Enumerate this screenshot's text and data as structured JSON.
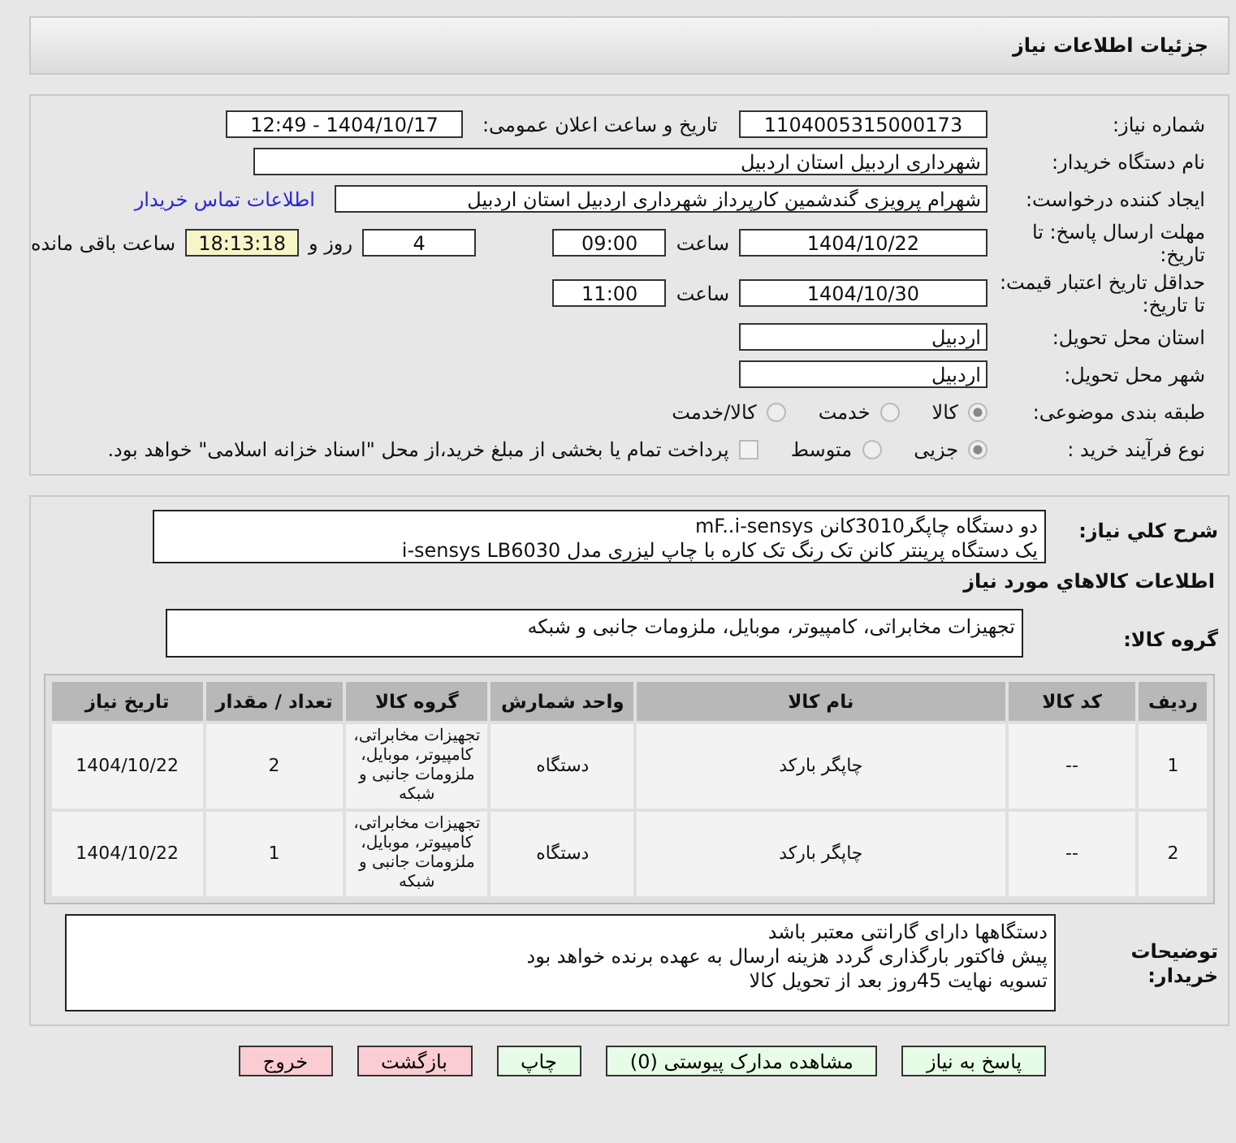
{
  "header": {
    "title": "جزئیات اطلاعات نیاز"
  },
  "need_number": {
    "label": "شماره نیاز:",
    "value": "1104005315000173"
  },
  "announce": {
    "label": "تاریخ و ساعت اعلان عمومی:",
    "value": "1404/10/17 - 12:49"
  },
  "buyer_org": {
    "label": "نام دستگاه خریدار:",
    "value": "شهرداری اردبیل استان اردبیل"
  },
  "requester": {
    "label": "ایجاد کننده درخواست:",
    "value": "شهرام پرویزی گندشمین کارپرداز شهرداری اردبیل استان اردبیل",
    "link": "اطلاعات تماس خریدار"
  },
  "deadline": {
    "label": "مهلت ارسال پاسخ: تا تاریخ:",
    "date": "1404/10/22",
    "time_label": "ساعت",
    "time": "09:00",
    "days": "4",
    "days_label": "روز و",
    "remaining": "18:13:18",
    "remaining_label": "ساعت باقی مانده"
  },
  "validity": {
    "label": "حداقل تاریخ اعتبار قیمت: تا تاریخ:",
    "date": "1404/10/30",
    "time_label": "ساعت",
    "time": "11:00"
  },
  "province": {
    "label": "استان محل تحویل:",
    "value": "اردبیل"
  },
  "city": {
    "label": "شهر محل تحویل:",
    "value": "اردبیل"
  },
  "category": {
    "label": "طبقه بندی موضوعی:",
    "options": [
      {
        "label": "کالا",
        "selected": true
      },
      {
        "label": "خدمت",
        "selected": false
      },
      {
        "label": "کالا/خدمت",
        "selected": false
      }
    ]
  },
  "process": {
    "label": "نوع فرآیند خرید :",
    "options": [
      {
        "label": "جزیی",
        "selected": true
      },
      {
        "label": "متوسط",
        "selected": false
      }
    ],
    "payment": {
      "label": "پرداخت تمام یا بخشی از مبلغ خرید،از محل \"اسناد خزانه اسلامی\" خواهد بود.",
      "checked": false
    }
  },
  "description": {
    "label": "شرح كلي نياز:",
    "lines": [
      "دو دستگاه چاپگر3010کانن mF..i-sensys",
      "یک دستگاه پرینتر کانن تک رنگ تک کاره با چاپ لیزری مدل i-sensys LB6030"
    ]
  },
  "goods_title": "اطلاعات كالاهاي مورد نياز",
  "goods_group": {
    "label": "گروه کالا:",
    "value": "تجهیزات مخابراتی، کامپیوتر، موبایل، ملزومات جانبی و شبکه"
  },
  "table": {
    "columns": [
      "ردیف",
      "کد کالا",
      "نام کالا",
      "واحد شمارش",
      "گروه کالا",
      "تعداد / مقدار",
      "تاریخ نیاز"
    ],
    "rows": [
      [
        "1",
        "--",
        "چاپگر بارکد",
        "دستگاه",
        "تجهیزات مخابراتی، کامپیوتر، موبایل، ملزومات جانبی و شبکه",
        "2",
        "1404/10/22"
      ],
      [
        "2",
        "--",
        "چاپگر بارکد",
        "دستگاه",
        "تجهیزات مخابراتی، کامپیوتر، موبایل، ملزومات جانبی و شبکه",
        "1",
        "1404/10/22"
      ]
    ]
  },
  "buyer_notes": {
    "label": "توضیحات خریدار:",
    "lines": [
      "دستگاهها دارای گارانتی معتبر باشد",
      "پیش فاکتور بارگذاری گردد هزینه ارسال به عهده برنده خواهد بود",
      "تسویه نهایت 45روز بعد از تحویل کالا"
    ]
  },
  "buttons": [
    {
      "label": "پاسخ به نیاز",
      "kind": "normal"
    },
    {
      "label": "مشاهده مدارک پیوستی (0)",
      "kind": "normal"
    },
    {
      "label": "چاپ",
      "kind": "normal"
    },
    {
      "label": "بازگشت",
      "kind": "danger"
    },
    {
      "label": "خروج",
      "kind": "danger"
    }
  ]
}
